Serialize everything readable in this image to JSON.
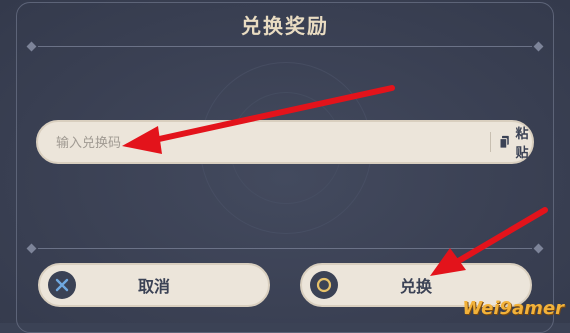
{
  "dialog": {
    "title": "兑换奖励"
  },
  "code_input": {
    "value": "",
    "placeholder": "输入兑换码",
    "paste_label": "粘贴"
  },
  "buttons": {
    "cancel_label": "取消",
    "confirm_label": "兑换"
  },
  "watermark": "Wei9amer",
  "colors": {
    "background": "#3b4255",
    "panel_light": "#ece5da",
    "title_text": "#e9dcc2",
    "arrow": "#e3131b"
  },
  "icons": {
    "cancel": "cross-circle-icon",
    "confirm": "ring-circle-icon",
    "paste": "clipboard-icon"
  }
}
